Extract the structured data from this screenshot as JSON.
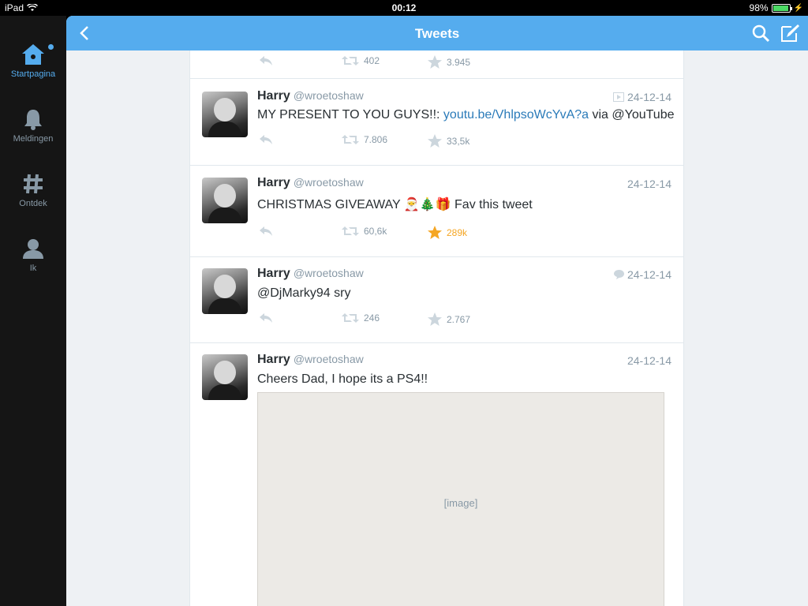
{
  "status_bar": {
    "device": "iPad",
    "time": "00:12",
    "battery": "98%",
    "battery_level": 0.98
  },
  "sidebar": {
    "items": [
      {
        "label": "Startpagina",
        "icon": "home-icon",
        "active": true
      },
      {
        "label": "Meldingen",
        "icon": "bell-icon",
        "active": false
      },
      {
        "label": "Ontdek",
        "icon": "hashtag-icon",
        "active": false
      },
      {
        "label": "Ik",
        "icon": "person-icon",
        "active": false
      }
    ]
  },
  "header": {
    "title": "Tweets"
  },
  "colors": {
    "accent": "#55acee",
    "link": "#2b7bb9",
    "favorited": "#f5a623",
    "muted": "#8899a6"
  },
  "partial_tweet": {
    "retweets": "402",
    "favorites": "3.945"
  },
  "tweets": [
    {
      "name": "Harry",
      "handle": "@wroetoshaw",
      "date": "24-12-14",
      "date_icon": "video-icon",
      "text_before": "MY PRESENT TO YOU GUYS!!: ",
      "link": "youtu.be/VhlpsoWcYvA?a",
      "text_after": " via @YouTube",
      "retweets": "7.806",
      "favorites": "33,5k"
    },
    {
      "name": "Harry",
      "handle": "@wroetoshaw",
      "date": "24-12-14",
      "text": "CHRISTMAS GIVEAWAY 🎅🎄🎁 Fav this tweet",
      "retweets": "60,6k",
      "favorites": "289k",
      "favorited": true
    },
    {
      "name": "Harry",
      "handle": "@wroetoshaw",
      "date": "24-12-14",
      "date_icon": "reply-bubble-icon",
      "text": "@DjMarky94 sry",
      "retweets": "246",
      "favorites": "2.767"
    },
    {
      "name": "Harry",
      "handle": "@wroetoshaw",
      "date": "24-12-14",
      "text": "Cheers Dad, I hope its a PS4!!",
      "media_label": "[image]"
    }
  ]
}
